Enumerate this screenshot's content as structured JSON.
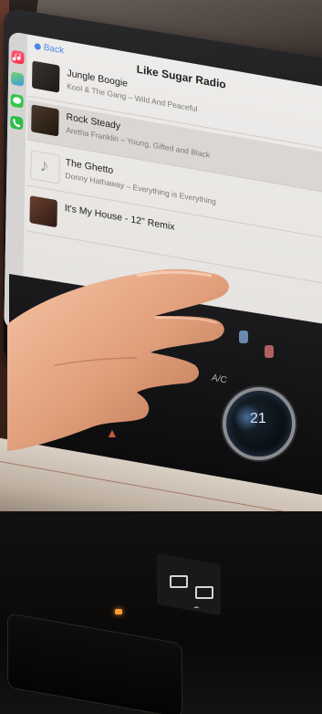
{
  "carplay": {
    "back_label": "Back",
    "station_title": "Like Sugar Radio",
    "tracks": [
      {
        "title": "Jungle Boogie",
        "subtitle": "Kool & The Gang – Wild And Peaceful"
      },
      {
        "title": "Rock Steady",
        "subtitle": "Aretha Franklin – Young, Gifted and Black"
      },
      {
        "title": "The Ghetto",
        "subtitle": "Donny Hathaway – Everything is Everything"
      },
      {
        "title": "It's My House - 12\" Remix",
        "subtitle": ""
      }
    ],
    "apps": [
      {
        "icon": "music-app-icon"
      },
      {
        "icon": "maps-app-icon"
      },
      {
        "icon": "messages-app-icon"
      },
      {
        "icon": "phone-app-icon"
      }
    ]
  },
  "climate": {
    "ac_label": "A/C",
    "temperature": "21"
  },
  "colors": {
    "screen_bg": "#eeecea",
    "accent_blue": "#4a8ae8",
    "trim": "#d9cfc3",
    "led": "#ff9a3a"
  }
}
